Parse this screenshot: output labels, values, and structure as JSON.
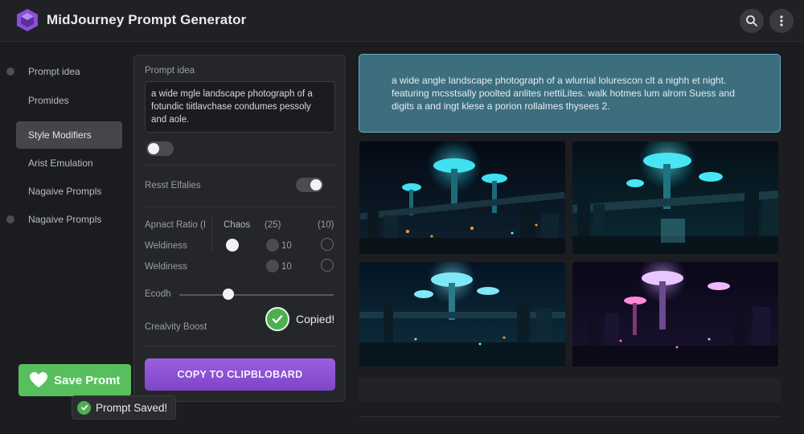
{
  "app": {
    "title": "MidJourney Prompt Generator"
  },
  "sidebar": {
    "items": [
      {
        "label": "Prompt idea"
      },
      {
        "label": "Promides"
      },
      {
        "label": "Style Modifiers"
      },
      {
        "label": "Arist Emulation"
      },
      {
        "label": "Nagaive Prompls"
      },
      {
        "label": "Nagaive Prompls"
      }
    ]
  },
  "panel": {
    "prompt_label": "Prompt idea",
    "prompt_value": "a wide mgle landscape photograph of a fotundic tiitlavchase condumes pessoly and aole.",
    "toggle1_on": false,
    "reset_label": "Resst Elfalies",
    "toggle2_on": true,
    "aspect_label": "Apnact Ratio (I",
    "chaos_label": "Chaos",
    "chaos_val1": "(25)",
    "chaos_val2": "(10)",
    "weirdness_label_1": "Weldiness",
    "weirdness_label_2": "Weldiness",
    "opt_10_a": "10",
    "opt_10_b": "10",
    "ecodh_label": "Ecodh",
    "ecodh_level": 0.3,
    "creativity_label": "Crealvity Boost",
    "copy_button": "COPY TO CLIPBLOBARD"
  },
  "copied_badge": "Copied!",
  "output": {
    "text": "a wide angle landscape photograph of a wlurrial lolurescon clt a nighh et night. featuring mcsstsally poolted anlites nettiLites. walk hotmes lum alrom Suess and digits a and ingt klese a porion rollalmes thysees 2."
  },
  "actions": {
    "save_button": "Save Promt",
    "toast": "Prompt Saved!"
  },
  "colors": {
    "accent": "#8b4fd6",
    "success": "#4caf50",
    "output_bg": "#3d6e7e"
  }
}
